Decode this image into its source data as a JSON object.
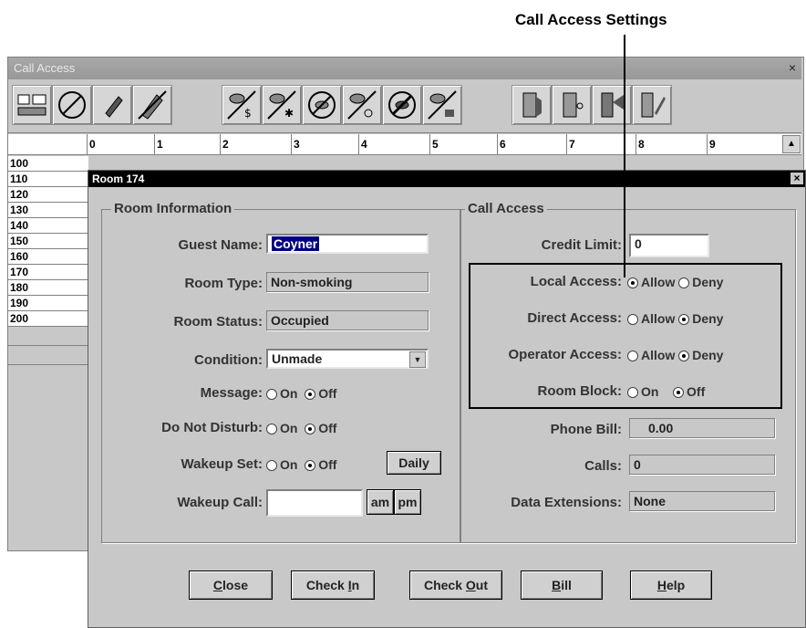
{
  "annotation": {
    "title": "Call Access Settings"
  },
  "outer_window": {
    "title": "Call Access",
    "close": "×"
  },
  "ruler": {
    "cells": [
      "0",
      "1",
      "2",
      "3",
      "4",
      "5",
      "6",
      "7",
      "8",
      "9"
    ],
    "scroll_up": "▲"
  },
  "rooms": [
    "100",
    "110",
    "120",
    "130",
    "140",
    "150",
    "160",
    "170",
    "180",
    "190",
    "200"
  ],
  "dialog": {
    "title": "Room 174",
    "close": "×",
    "room_info": {
      "legend": "Room Information",
      "guest_name_label": "Guest Name:",
      "guest_name_value": "Coyner",
      "room_type_label": "Room Type:",
      "room_type_value": "Non-smoking",
      "room_status_label": "Room Status:",
      "room_status_value": "Occupied",
      "condition_label": "Condition:",
      "condition_value": "Unmade",
      "message_label": "Message:",
      "message_on": "On",
      "message_off": "Off",
      "dnd_label": "Do Not Disturb:",
      "dnd_on": "On",
      "dnd_off": "Off",
      "wakeup_set_label": "Wakeup Set:",
      "wakeup_on": "On",
      "wakeup_off": "Off",
      "daily_button": "Daily",
      "wakeup_call_label": "Wakeup Call:",
      "wakeup_call_value": "",
      "am": "am",
      "pm": "pm"
    },
    "call_access": {
      "legend": "Call Access",
      "credit_limit_label": "Credit Limit:",
      "credit_limit_value": "0",
      "local_label": "Local Access:",
      "local_allow": "Allow",
      "local_deny": "Deny",
      "direct_label": "Direct Access:",
      "direct_allow": "Allow",
      "direct_deny": "Deny",
      "operator_label": "Operator Access:",
      "operator_allow": "Allow",
      "operator_deny": "Deny",
      "room_block_label": "Room Block:",
      "room_block_on": "On",
      "room_block_off": "Off",
      "phone_bill_label": "Phone Bill:",
      "phone_bill_value": "0.00",
      "calls_label": "Calls:",
      "calls_value": "0",
      "data_ext_label": "Data Extensions:",
      "data_ext_value": "None"
    },
    "buttons": {
      "close_first": "C",
      "close_rest": "lose",
      "checkin_first": "Check ",
      "checkin_u": "I",
      "checkin_rest": "n",
      "checkout_first": "Check ",
      "checkout_u": "O",
      "checkout_rest": "ut",
      "bill_u": "B",
      "bill_rest": "ill",
      "help_u": "H",
      "help_rest": "elp"
    }
  }
}
